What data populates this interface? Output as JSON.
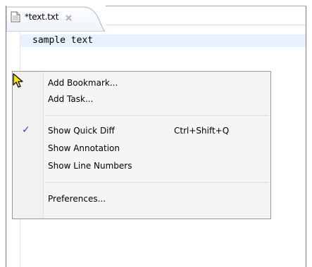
{
  "tab": {
    "label": "*text.txt",
    "doc_icon": "text-document-icon",
    "close_icon": "close-icon"
  },
  "editor": {
    "content": "sample text",
    "current_line_color": "#e8f2fe"
  },
  "cursor": {
    "icon": "mouse-pointer-icon"
  },
  "context_menu": {
    "items": [
      {
        "label": "Add Bookmark...",
        "accel": "",
        "checked": false
      },
      {
        "label": "Add Task...",
        "accel": "",
        "checked": false
      },
      {
        "label": "Show Quick Diff",
        "accel": "Ctrl+Shift+Q",
        "checked": true,
        "check_glyph": "✓"
      },
      {
        "label": "Show Annotation",
        "accel": "",
        "checked": false
      },
      {
        "label": "Show Line Numbers",
        "accel": "",
        "checked": false
      },
      {
        "label": "Preferences...",
        "accel": "",
        "checked": false
      }
    ]
  },
  "colors": {
    "check": "#2a4fa0",
    "menu_bg": "#f5f5f5",
    "menu_border": "#979797"
  }
}
